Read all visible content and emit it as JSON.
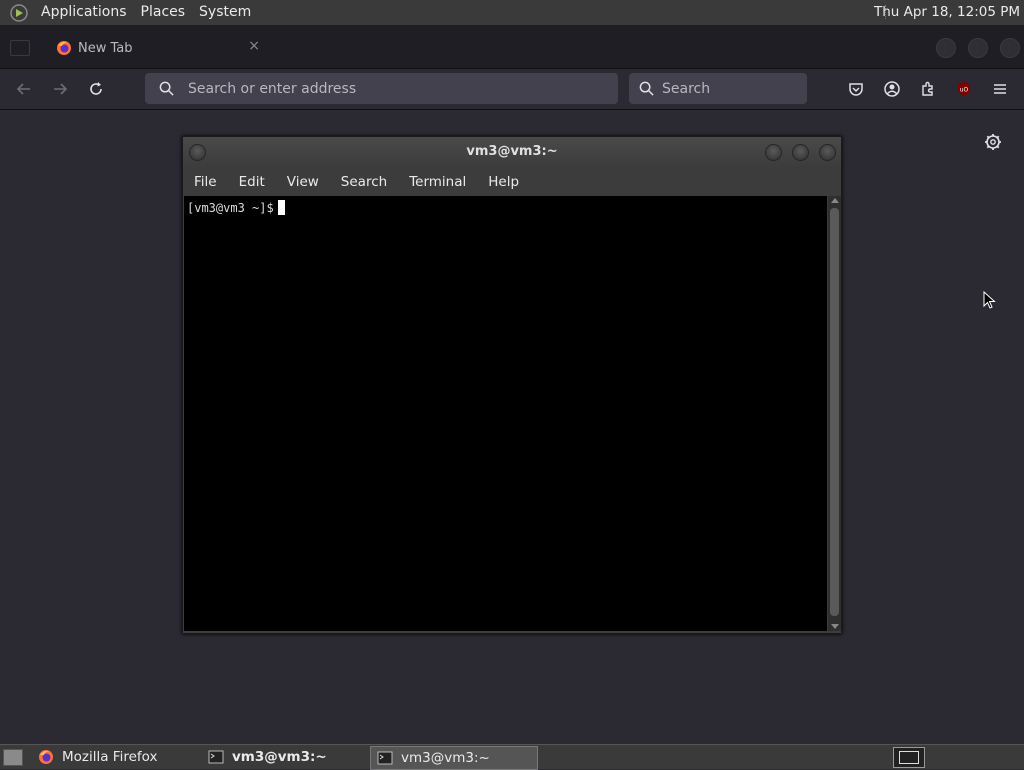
{
  "system_panel": {
    "menus": [
      "Applications",
      "Places",
      "System"
    ],
    "clock": "Thu Apr 18, 12:05 PM"
  },
  "browser": {
    "tab": {
      "label": "New Tab",
      "close": "×"
    },
    "address_placeholder": "Search or enter address",
    "search_placeholder": "Search"
  },
  "terminal": {
    "title": "vm3@vm3:~",
    "menu": [
      "File",
      "Edit",
      "View",
      "Search",
      "Terminal",
      "Help"
    ],
    "prompt": "[vm3@vm3 ~]$"
  },
  "taskbar": {
    "tasks": [
      {
        "label": "Mozilla Firefox",
        "icon": "firefox-icon"
      },
      {
        "label": "vm3@vm3:~",
        "icon": "terminal-icon"
      },
      {
        "label": "vm3@vm3:~",
        "icon": "terminal-icon"
      }
    ]
  },
  "colors": {
    "panel": "#3a3a3a",
    "browser_bg": "#2b2a33",
    "urlbar": "#42414d",
    "terminal_bg": "#000000"
  }
}
